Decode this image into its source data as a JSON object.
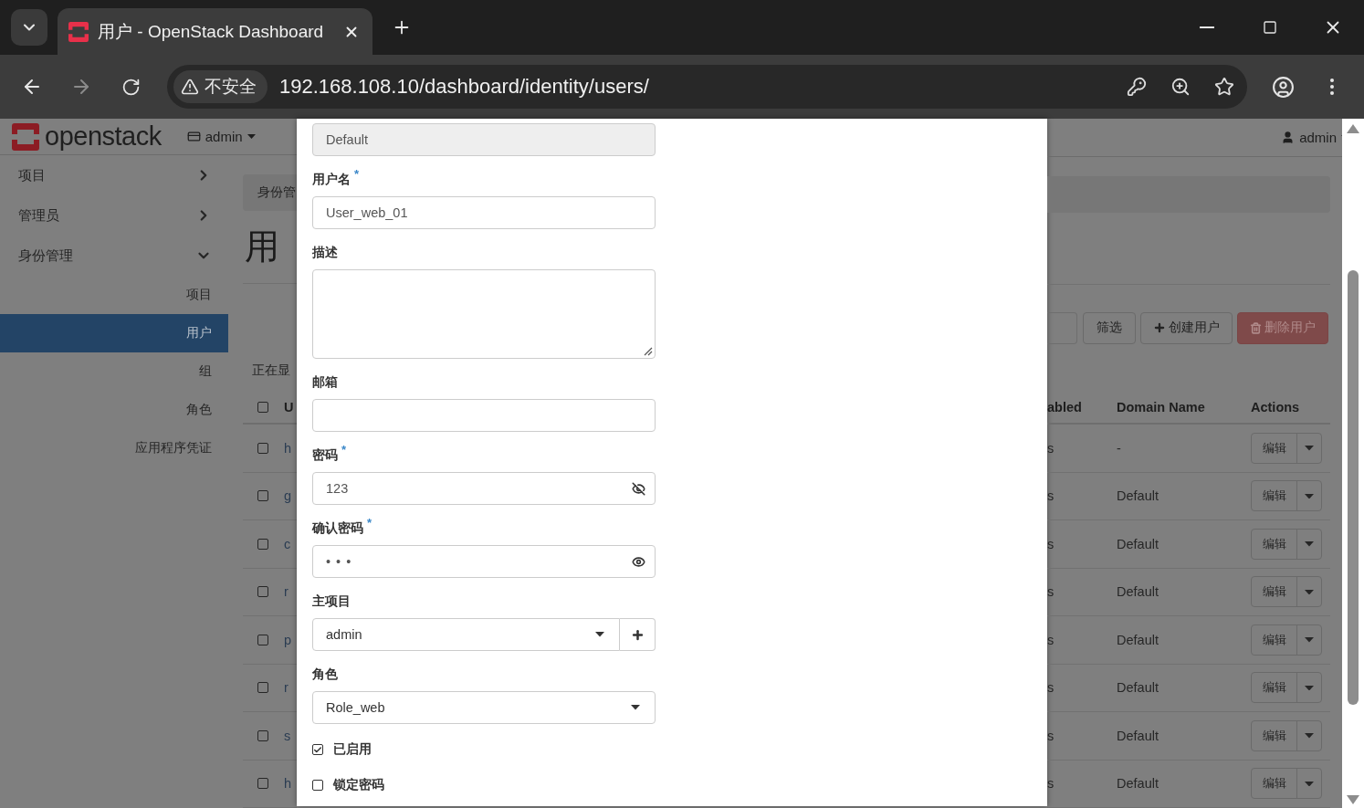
{
  "browser": {
    "tab_title": "用户 - OpenStack Dashboard",
    "security_label": "不安全",
    "url": "192.168.108.10/dashboard/identity/users/"
  },
  "header": {
    "logo": "openstack",
    "project": "admin",
    "user": "admin"
  },
  "sidebar": {
    "items": [
      {
        "label": "项目",
        "expanded": false
      },
      {
        "label": "管理员",
        "expanded": false
      },
      {
        "label": "身份管理",
        "expanded": true,
        "children": [
          {
            "label": "项目",
            "selected": false
          },
          {
            "label": "用户",
            "selected": true
          },
          {
            "label": "组",
            "selected": false
          },
          {
            "label": "角色",
            "selected": false
          },
          {
            "label": "应用程序凭证",
            "selected": false
          }
        ]
      }
    ]
  },
  "page": {
    "breadcrumb": "身份管",
    "heading": "用",
    "count_text": "正在显"
  },
  "toolbar": {
    "buttons": [
      {
        "kind": "filter",
        "label": "筛选",
        "disabled": false
      },
      {
        "kind": "create",
        "label": "创建用户",
        "disabled": false
      },
      {
        "kind": "delete",
        "label": "删除用户",
        "disabled": true
      }
    ]
  },
  "table": {
    "select_all_checked": false,
    "columns": [
      "U",
      "abled",
      "Domain Name",
      "Actions"
    ],
    "rows": [
      {
        "checked": false,
        "name": "h",
        "enabled": "s",
        "domain": "-",
        "action": "编辑"
      },
      {
        "checked": false,
        "name": "g",
        "enabled": "s",
        "domain": "Default",
        "action": "编辑"
      },
      {
        "checked": false,
        "name": "c",
        "enabled": "s",
        "domain": "Default",
        "action": "编辑"
      },
      {
        "checked": false,
        "name": "r",
        "enabled": "s",
        "domain": "Default",
        "action": "编辑"
      },
      {
        "checked": false,
        "name": "p",
        "enabled": "s",
        "domain": "Default",
        "action": "编辑"
      },
      {
        "checked": false,
        "name": "r",
        "enabled": "s",
        "domain": "Default",
        "action": "编辑"
      },
      {
        "checked": false,
        "name": "s",
        "enabled": "s",
        "domain": "Default",
        "action": "编辑"
      },
      {
        "checked": false,
        "name": "h",
        "enabled": "s",
        "domain": "Default",
        "action": "编辑"
      }
    ]
  },
  "form": {
    "fields": [
      {
        "kind": "input",
        "value": "Default",
        "disabled": true
      },
      {
        "kind": "input",
        "label": "用户名",
        "required_mark": "*",
        "value": "User_web_01",
        "disabled": false
      },
      {
        "kind": "textarea",
        "label": "描述"
      },
      {
        "kind": "input",
        "label": "邮箱",
        "disabled": false
      },
      {
        "kind": "password",
        "label": "密码",
        "required_mark": "*",
        "value": "123",
        "revealed": true
      },
      {
        "kind": "password",
        "label": "确认密码",
        "required_mark": "*",
        "value": "• • •",
        "revealed": false
      },
      {
        "kind": "select",
        "label": "主项目",
        "value": "admin",
        "addable": true
      },
      {
        "kind": "select",
        "label": "角色",
        "value": "Role_web",
        "addable": false
      },
      {
        "kind": "checkbox",
        "label": "已启用",
        "checked": true
      },
      {
        "kind": "checkbox",
        "label": "锁定密码",
        "checked": false
      }
    ]
  }
}
